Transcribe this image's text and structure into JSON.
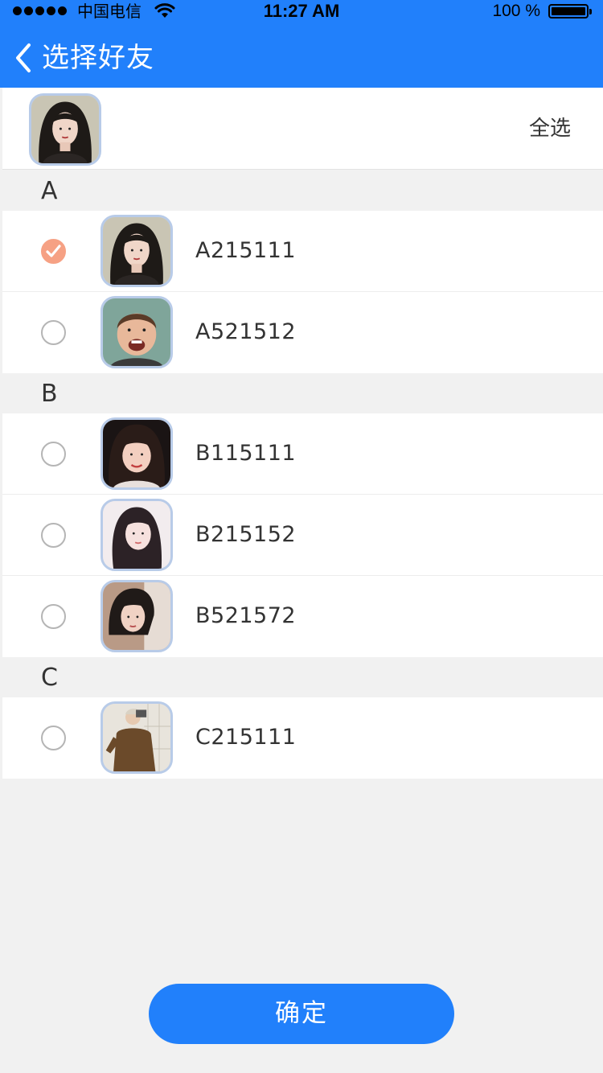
{
  "status_bar": {
    "carrier": "中国电信",
    "time": "11:27 AM",
    "battery_text": "100 %"
  },
  "header": {
    "title": "选择好友"
  },
  "selected_bar": {
    "select_all_label": "全选"
  },
  "sections": [
    {
      "letter": "A",
      "contacts": [
        {
          "name": "A215111",
          "checked": true
        },
        {
          "name": "A521512",
          "checked": false
        }
      ]
    },
    {
      "letter": "B",
      "contacts": [
        {
          "name": "B115111",
          "checked": false
        },
        {
          "name": "B215152",
          "checked": false
        },
        {
          "name": "B521572",
          "checked": false
        }
      ]
    },
    {
      "letter": "C",
      "contacts": [
        {
          "name": "C215111",
          "checked": false
        }
      ]
    }
  ],
  "confirm_label": "确定",
  "colors": {
    "primary": "#2180fb",
    "checked": "#f6a184",
    "avatar_border": "#b8cbe8"
  },
  "icons": {
    "back": "chevron-left-icon",
    "check": "check-icon",
    "wifi": "wifi-icon",
    "battery": "battery-icon"
  }
}
